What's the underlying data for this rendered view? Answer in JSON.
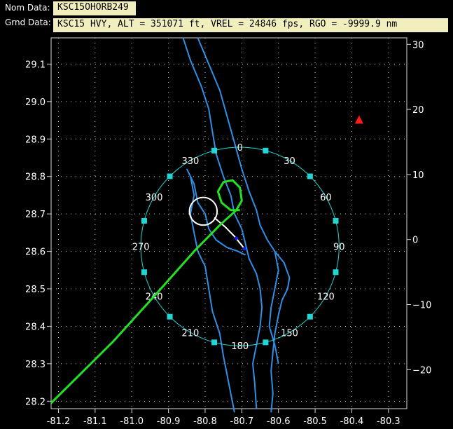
{
  "header": {
    "nom_label": "Nom Data:",
    "nom_value": "KSC15OHORB249",
    "grnd_label": "Grnd Data:",
    "grnd_value": "KSC15 HVY, ALT = 351071 ft, VREL = 24846 fps, RGO = -9999.9 nm"
  },
  "colors": {
    "background": "#000000",
    "grid": "#c8c8c8",
    "coastline": "#2f8fe6",
    "range_ring": "#22d6d6",
    "ground_track": "#22e122",
    "approach_circle": "#ffffff",
    "marker_red": "#ff1a1a",
    "marker_blue": "#1a1aff"
  },
  "chart_data": {
    "type": "map",
    "x_axis": {
      "range": [
        -81.22,
        -80.25
      ],
      "ticks": [
        -81.2,
        -81.1,
        -81.0,
        -80.9,
        -80.8,
        -80.7,
        -80.6,
        -80.5,
        -80.4,
        -80.3
      ]
    },
    "y_axis_left": {
      "range": [
        28.18,
        29.17
      ],
      "ticks": [
        28.2,
        28.3,
        28.4,
        28.5,
        28.6,
        28.7,
        28.8,
        28.9,
        29.0,
        29.1
      ]
    },
    "y_axis_right": {
      "range": [
        -26,
        31
      ],
      "ticks": [
        -20,
        -10,
        0,
        10,
        20,
        30
      ]
    },
    "range_ring": {
      "center": [
        -80.705,
        28.613
      ],
      "radius_deg_lat": 0.265,
      "dot_step_deg": 15,
      "labels": [
        "0",
        "30",
        "60",
        "90",
        "120",
        "150",
        "180",
        "210",
        "240",
        "270",
        "300",
        "330"
      ]
    },
    "ground_track": [
      [
        -81.22,
        28.195
      ],
      [
        -81.05,
        28.36
      ],
      [
        -80.93,
        28.49
      ],
      [
        -80.83,
        28.6
      ],
      [
        -80.76,
        28.67
      ],
      [
        -80.715,
        28.71
      ],
      [
        -80.7,
        28.735
      ],
      [
        -80.705,
        28.77
      ],
      [
        -80.725,
        28.79
      ],
      [
        -80.75,
        28.785
      ],
      [
        -80.765,
        28.76
      ],
      [
        -80.755,
        28.73
      ],
      [
        -80.73,
        28.71
      ],
      [
        -80.705,
        28.71
      ]
    ],
    "approach_circle": {
      "center": [
        -80.805,
        28.707
      ],
      "radius_deg_lat": 0.037
    },
    "approach_line": [
      [
        -80.775,
        28.69
      ],
      [
        -80.745,
        28.665
      ],
      [
        -80.72,
        28.64
      ],
      [
        -80.695,
        28.61
      ]
    ],
    "markers": [
      {
        "name": "red-triangle",
        "lon": -80.38,
        "lat": 28.95
      },
      {
        "name": "blue-point-1",
        "lon": -80.715,
        "lat": 28.635
      },
      {
        "name": "blue-point-2",
        "lon": -80.693,
        "lat": 28.607
      }
    ],
    "coastlines": [
      [
        [
          -80.82,
          29.17
        ],
        [
          -80.79,
          29.1
        ],
        [
          -80.76,
          29.03
        ],
        [
          -80.74,
          28.96
        ],
        [
          -80.72,
          28.89
        ],
        [
          -80.7,
          28.82
        ],
        [
          -80.68,
          28.76
        ],
        [
          -80.66,
          28.71
        ],
        [
          -80.65,
          28.67
        ],
        [
          -80.63,
          28.63
        ],
        [
          -80.61,
          28.6
        ],
        [
          -80.585,
          28.57
        ],
        [
          -80.57,
          28.53
        ],
        [
          -80.575,
          28.5
        ],
        [
          -80.59,
          28.47
        ],
        [
          -80.6,
          28.43
        ],
        [
          -80.61,
          28.38
        ],
        [
          -80.615,
          28.33
        ],
        [
          -80.62,
          28.28
        ],
        [
          -80.615,
          28.22
        ],
        [
          -80.62,
          28.17
        ]
      ],
      [
        [
          -80.86,
          29.17
        ],
        [
          -80.84,
          29.11
        ],
        [
          -80.81,
          29.04
        ],
        [
          -80.79,
          28.98
        ],
        [
          -80.78,
          28.92
        ],
        [
          -80.77,
          28.86
        ],
        [
          -80.75,
          28.8
        ],
        [
          -80.73,
          28.75
        ],
        [
          -80.72,
          28.7
        ],
        [
          -80.7,
          28.66
        ],
        [
          -80.69,
          28.62
        ],
        [
          -80.68,
          28.58
        ],
        [
          -80.66,
          28.54
        ],
        [
          -80.65,
          28.5
        ],
        [
          -80.645,
          28.45
        ],
        [
          -80.65,
          28.4
        ],
        [
          -80.66,
          28.35
        ],
        [
          -80.67,
          28.3
        ],
        [
          -80.665,
          28.25
        ],
        [
          -80.66,
          28.18
        ]
      ],
      [
        [
          -80.85,
          28.82
        ],
        [
          -80.83,
          28.78
        ],
        [
          -80.82,
          28.73
        ],
        [
          -80.8,
          28.7
        ],
        [
          -80.79,
          28.66
        ],
        [
          -80.77,
          28.63
        ],
        [
          -80.74,
          28.61
        ],
        [
          -80.71,
          28.6
        ],
        [
          -80.69,
          28.59
        ]
      ],
      [
        [
          -80.84,
          28.8
        ],
        [
          -80.83,
          28.75
        ],
        [
          -80.84,
          28.7
        ],
        [
          -80.83,
          28.65
        ],
        [
          -80.82,
          28.6
        ],
        [
          -80.8,
          28.56
        ],
        [
          -80.79,
          28.5
        ],
        [
          -80.78,
          28.44
        ],
        [
          -80.76,
          28.38
        ],
        [
          -80.75,
          28.32
        ],
        [
          -80.74,
          28.27
        ],
        [
          -80.73,
          28.22
        ],
        [
          -80.72,
          28.17
        ]
      ],
      [
        [
          -80.61,
          28.6
        ],
        [
          -80.6,
          28.55
        ],
        [
          -80.61,
          28.5
        ],
        [
          -80.62,
          28.45
        ],
        [
          -80.625,
          28.4
        ],
        [
          -80.61,
          28.35
        ],
        [
          -80.6,
          28.3
        ]
      ]
    ]
  }
}
